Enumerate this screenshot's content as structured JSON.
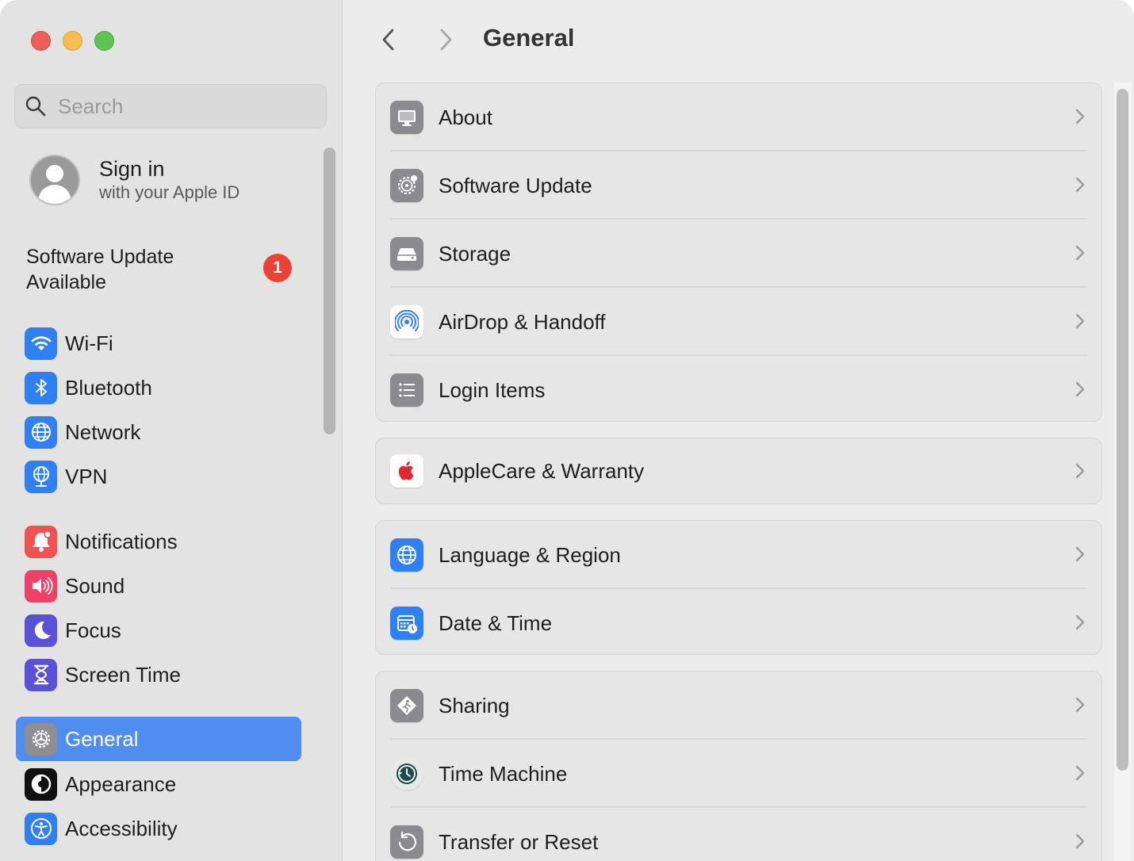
{
  "window": {
    "traffic_lights": [
      "close",
      "minimize",
      "zoom"
    ]
  },
  "sidebar": {
    "search": {
      "placeholder": "Search",
      "value": ""
    },
    "account": {
      "title": "Sign in",
      "subtitle": "with your Apple ID"
    },
    "update": {
      "text": "Software Update Available",
      "badge": "1"
    },
    "items": [
      {
        "label": "Wi-Fi",
        "icon": "wifi-icon",
        "color": "#2f80f5"
      },
      {
        "label": "Bluetooth",
        "icon": "bluetooth-icon",
        "color": "#2f80f5"
      },
      {
        "label": "Network",
        "icon": "globe-icon",
        "color": "#2f80f5"
      },
      {
        "label": "VPN",
        "icon": "vpn-globe-icon",
        "color": "#2f80f5"
      },
      {
        "label": "Notifications",
        "icon": "bell-icon",
        "color": "#f0524f"
      },
      {
        "label": "Sound",
        "icon": "speaker-icon",
        "color": "#f0406a"
      },
      {
        "label": "Focus",
        "icon": "moon-icon",
        "color": "#5b50d8"
      },
      {
        "label": "Screen Time",
        "icon": "hourglass-icon",
        "color": "#5b50d8"
      },
      {
        "label": "General",
        "icon": "gear-icon",
        "color": "#8e8e93",
        "active": true
      },
      {
        "label": "Appearance",
        "icon": "appearance-icon",
        "color": "#111111"
      },
      {
        "label": "Accessibility",
        "icon": "accessibility-icon",
        "color": "#2f80f5"
      }
    ]
  },
  "main": {
    "title": "General",
    "groups": [
      [
        {
          "label": "About",
          "icon": "display-icon"
        },
        {
          "label": "Software Update",
          "icon": "gear-badge-icon"
        },
        {
          "label": "Storage",
          "icon": "drive-icon"
        },
        {
          "label": "AirDrop & Handoff",
          "icon": "airdrop-icon"
        },
        {
          "label": "Login Items",
          "icon": "list-icon"
        }
      ],
      [
        {
          "label": "AppleCare & Warranty",
          "icon": "apple-icon"
        }
      ],
      [
        {
          "label": "Language & Region",
          "icon": "language-globe-icon"
        },
        {
          "label": "Date & Time",
          "icon": "calendar-clock-icon"
        }
      ],
      [
        {
          "label": "Sharing",
          "icon": "sharing-icon"
        },
        {
          "label": "Time Machine",
          "icon": "time-machine-icon"
        },
        {
          "label": "Transfer or Reset",
          "icon": "reset-icon"
        }
      ]
    ]
  }
}
